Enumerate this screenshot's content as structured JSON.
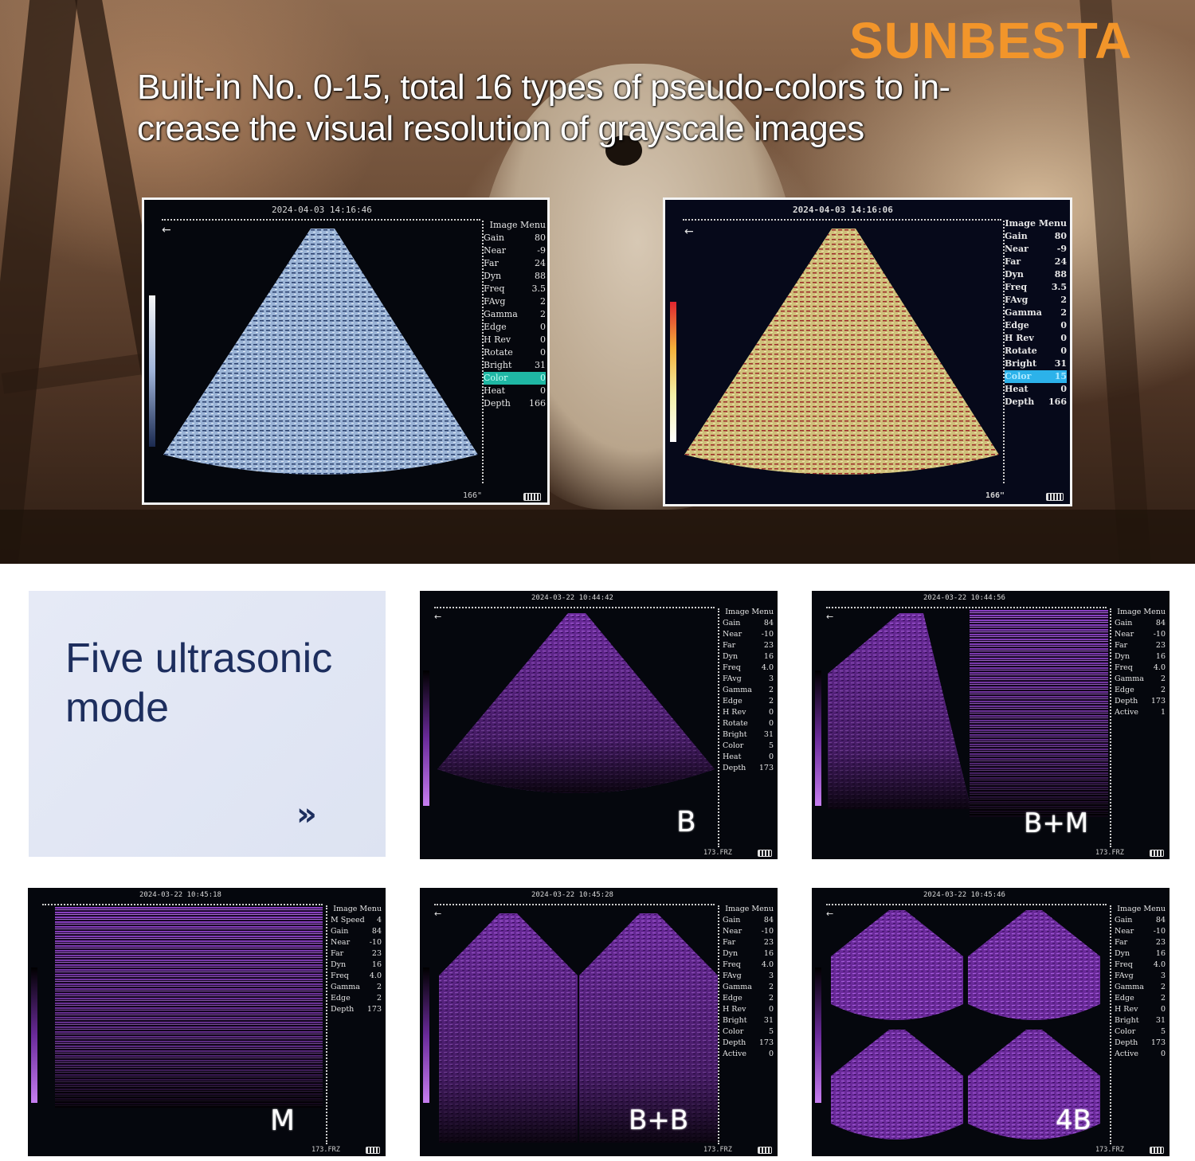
{
  "brand": "SUNBESTA",
  "headline": "Built-in No. 0-15, total 16 types of pseudo-colors to increase the visual resolution of grayscale images",
  "headline_lines": [
    "Built-in No. 0-15, total 16 types of pseudo-colors to in-",
    "crease the visual resolution of grayscale images"
  ],
  "colors": {
    "brand": "#f2952a",
    "card_text": "#1d2e5e",
    "purple_image": "#7a2fb0",
    "menu_highlight_green": "#1fb7a4",
    "menu_highlight_blue": "#2cb2ea"
  },
  "top_screens": [
    {
      "timestamp": "2024-04-03  14:16:46",
      "footer": "166\"",
      "menu_title": "Image Menu",
      "menu": [
        {
          "label": "Gain",
          "value": "80"
        },
        {
          "label": "Near",
          "value": "-9"
        },
        {
          "label": "Far",
          "value": "24"
        },
        {
          "label": "Dyn",
          "value": "88"
        },
        {
          "label": "Freq",
          "value": "3.5"
        },
        {
          "label": "FAvg",
          "value": "2"
        },
        {
          "label": "Gamma",
          "value": "2"
        },
        {
          "label": "Edge",
          "value": "0"
        },
        {
          "label": "H Rev",
          "value": "0"
        },
        {
          "label": "Rotate",
          "value": "0"
        },
        {
          "label": "Bright",
          "value": "31"
        },
        {
          "label": "Color",
          "value": "0"
        },
        {
          "label": "Heat",
          "value": "0"
        },
        {
          "label": "Depth",
          "value": "166"
        }
      ]
    },
    {
      "timestamp": "2024-04-03  14:16:06",
      "footer": "166\"",
      "menu_title": "Image Menu",
      "menu": [
        {
          "label": "Gain",
          "value": "80"
        },
        {
          "label": "Near",
          "value": "-9"
        },
        {
          "label": "Far",
          "value": "24"
        },
        {
          "label": "Dyn",
          "value": "88"
        },
        {
          "label": "Freq",
          "value": "3.5"
        },
        {
          "label": "FAvg",
          "value": "2"
        },
        {
          "label": "Gamma",
          "value": "2"
        },
        {
          "label": "Edge",
          "value": "0"
        },
        {
          "label": "H Rev",
          "value": "0"
        },
        {
          "label": "Rotate",
          "value": "0"
        },
        {
          "label": "Bright",
          "value": "31"
        },
        {
          "label": "Color",
          "value": "15"
        },
        {
          "label": "Heat",
          "value": "0"
        },
        {
          "label": "Depth",
          "value": "166"
        }
      ]
    }
  ],
  "card": {
    "title_line1": "Five ultrasonic",
    "title_line2": "mode",
    "arrow": "»"
  },
  "modes": [
    {
      "mode": "B",
      "timestamp": "2024-03-22  10:44:42",
      "footer": "173.FRZ",
      "menu_title": "Image Menu",
      "menu": [
        {
          "label": "Gain",
          "value": "84"
        },
        {
          "label": "Near",
          "value": "-10"
        },
        {
          "label": "Far",
          "value": "23"
        },
        {
          "label": "Dyn",
          "value": "16"
        },
        {
          "label": "Freq",
          "value": "4.0"
        },
        {
          "label": "FAvg",
          "value": "3"
        },
        {
          "label": "Gamma",
          "value": "2"
        },
        {
          "label": "Edge",
          "value": "2"
        },
        {
          "label": "H Rev",
          "value": "0"
        },
        {
          "label": "Rotate",
          "value": "0"
        },
        {
          "label": "Bright",
          "value": "31"
        },
        {
          "label": "Color",
          "value": "5"
        },
        {
          "label": "Heat",
          "value": "0"
        },
        {
          "label": "Depth",
          "value": "173"
        }
      ]
    },
    {
      "mode": "B+M",
      "timestamp": "2024-03-22  10:44:56",
      "footer": "173.FRZ",
      "menu_title": "Image Menu",
      "menu": [
        {
          "label": "Gain",
          "value": "84"
        },
        {
          "label": "Near",
          "value": "-10"
        },
        {
          "label": "Far",
          "value": "23"
        },
        {
          "label": "Dyn",
          "value": "16"
        },
        {
          "label": "Freq",
          "value": "4.0"
        },
        {
          "label": "Gamma",
          "value": "2"
        },
        {
          "label": "Edge",
          "value": "2"
        },
        {
          "label": "Depth",
          "value": "173"
        },
        {
          "label": "Active",
          "value": "1"
        }
      ]
    },
    {
      "mode": "M",
      "timestamp": "2024-03-22  10:45:18",
      "footer": "173.FRZ",
      "menu_title": "Image Menu",
      "menu": [
        {
          "label": "M Speed",
          "value": "4"
        },
        {
          "label": "Gain",
          "value": "84"
        },
        {
          "label": "Near",
          "value": "-10"
        },
        {
          "label": "Far",
          "value": "23"
        },
        {
          "label": "Dyn",
          "value": "16"
        },
        {
          "label": "Freq",
          "value": "4.0"
        },
        {
          "label": "Gamma",
          "value": "2"
        },
        {
          "label": "Edge",
          "value": "2"
        },
        {
          "label": "Depth",
          "value": "173"
        }
      ]
    },
    {
      "mode": "B+B",
      "timestamp": "2024-03-22  10:45:28",
      "footer": "173.FRZ",
      "menu_title": "Image Menu",
      "menu": [
        {
          "label": "Gain",
          "value": "84"
        },
        {
          "label": "Near",
          "value": "-10"
        },
        {
          "label": "Far",
          "value": "23"
        },
        {
          "label": "Dyn",
          "value": "16"
        },
        {
          "label": "Freq",
          "value": "4.0"
        },
        {
          "label": "FAvg",
          "value": "3"
        },
        {
          "label": "Gamma",
          "value": "2"
        },
        {
          "label": "Edge",
          "value": "2"
        },
        {
          "label": "H Rev",
          "value": "0"
        },
        {
          "label": "Bright",
          "value": "31"
        },
        {
          "label": "Color",
          "value": "5"
        },
        {
          "label": "Depth",
          "value": "173"
        },
        {
          "label": "Active",
          "value": "0"
        }
      ]
    },
    {
      "mode": "4B",
      "timestamp": "2024-03-22  10:45:46",
      "footer": "173.FRZ",
      "menu_title": "Image Menu",
      "menu": [
        {
          "label": "Gain",
          "value": "84"
        },
        {
          "label": "Near",
          "value": "-10"
        },
        {
          "label": "Far",
          "value": "23"
        },
        {
          "label": "Dyn",
          "value": "16"
        },
        {
          "label": "Freq",
          "value": "4.0"
        },
        {
          "label": "FAvg",
          "value": "3"
        },
        {
          "label": "Gamma",
          "value": "2"
        },
        {
          "label": "Edge",
          "value": "2"
        },
        {
          "label": "H Rev",
          "value": "0"
        },
        {
          "label": "Bright",
          "value": "31"
        },
        {
          "label": "Color",
          "value": "5"
        },
        {
          "label": "Depth",
          "value": "173"
        },
        {
          "label": "Active",
          "value": "0"
        }
      ]
    }
  ]
}
